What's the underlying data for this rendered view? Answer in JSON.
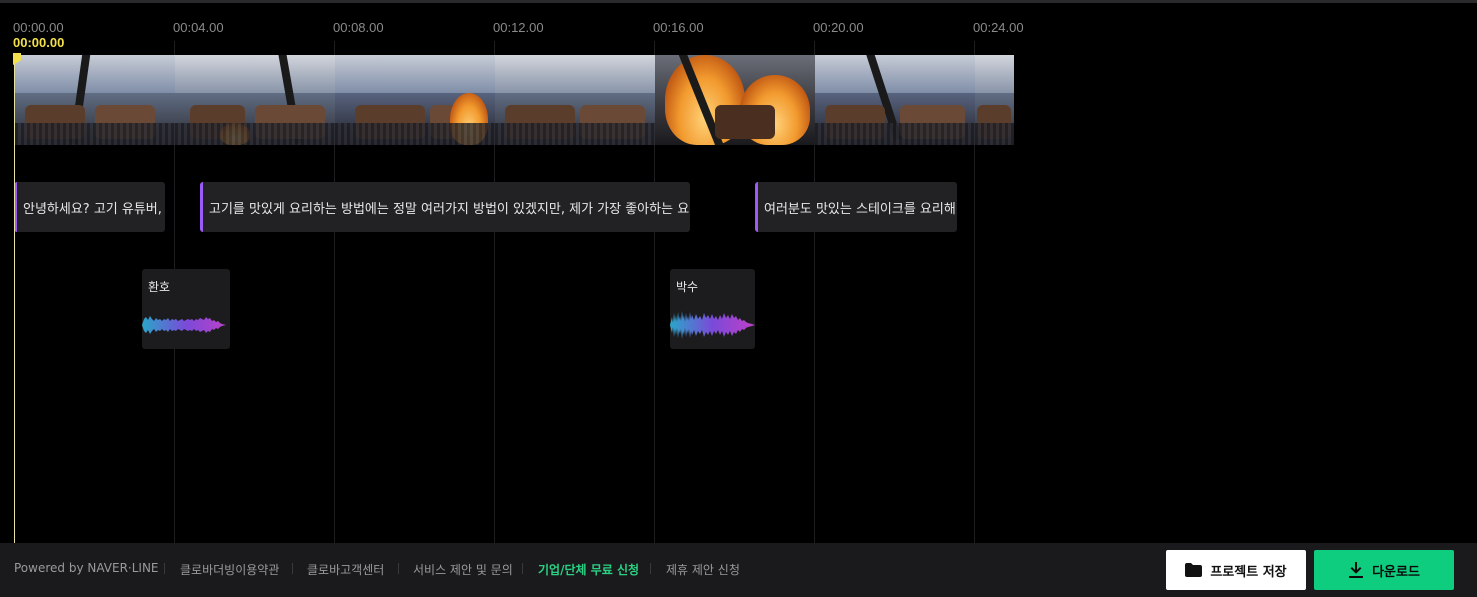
{
  "timeline": {
    "ruler": [
      "00:00.00",
      "00:04.00",
      "00:08.00",
      "00:12.00",
      "00:16.00",
      "00:20.00",
      "00:24.00"
    ],
    "playhead_time": "00:00.00",
    "playhead_color": "#f2e14c",
    "captions": [
      "안녕하세요? 고기 유튜버, 고",
      "고기를 맛있게 요리하는 방법에는 정말 여러가지 방법이 있겠지만, 제가 가장 좋아하는 요리법",
      "여러분도 맛있는 스테이크를 요리해 보"
    ],
    "caption_accent": "#9b5cf5",
    "sound_effects": [
      {
        "label": "환호"
      },
      {
        "label": "박수"
      }
    ]
  },
  "footer": {
    "links": [
      "Powered by NAVER·LINE",
      "클로바더빙이용약관",
      "클로바고객센터",
      "서비스 제안 및 문의",
      "기업/단체 무료 신청",
      "제휴 제안 신청"
    ],
    "highlight_color": "#2ad183",
    "save_label": "프로젝트 저장",
    "download_label": "다운로드",
    "download_color": "#0fcd7e"
  }
}
